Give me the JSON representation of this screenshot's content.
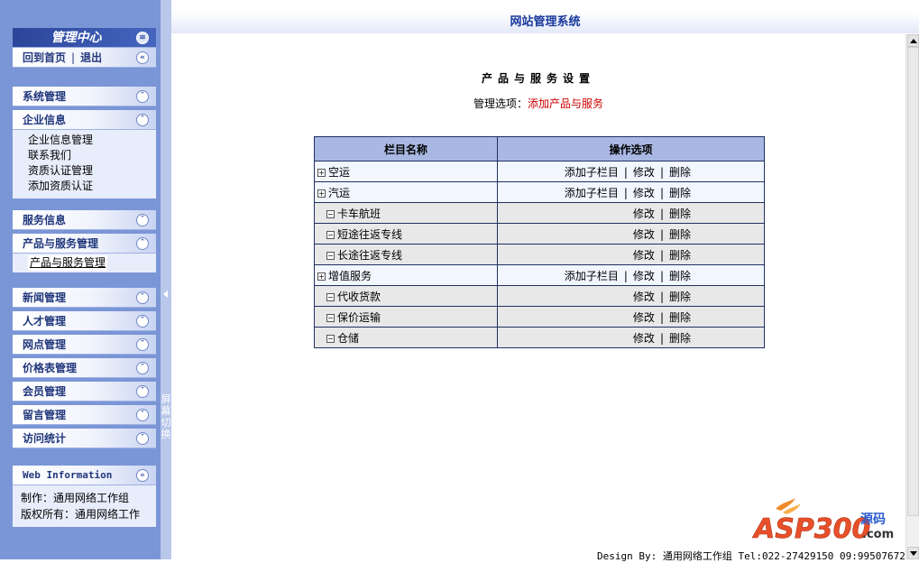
{
  "header": {
    "title": "网站管理系统"
  },
  "sidebar": {
    "center_title": "管理中心",
    "top_links": {
      "home": "回到首页",
      "separator": "|",
      "logout": "退出"
    },
    "menus": [
      {
        "label": "系统管理",
        "expanded": false,
        "items": []
      },
      {
        "label": "企业信息",
        "expanded": true,
        "items": [
          "企业信息管理",
          "联系我们",
          "资质认证管理",
          "添加资质认证"
        ]
      },
      {
        "label": "服务信息",
        "expanded": false,
        "items": []
      },
      {
        "label": "产品与服务管理",
        "expanded": true,
        "items": [
          "产品与服务管理"
        ]
      },
      {
        "label": "新闻管理",
        "expanded": false
      },
      {
        "label": "人才管理",
        "expanded": false
      },
      {
        "label": "网点管理",
        "expanded": false
      },
      {
        "label": "价格表管理",
        "expanded": false
      },
      {
        "label": "会员管理",
        "expanded": false
      },
      {
        "label": "留言管理",
        "expanded": false
      },
      {
        "label": "访问统计",
        "expanded": false
      }
    ],
    "web_info": {
      "title": "Web Information",
      "made_by": "制作：通用网络工作组",
      "copyright": "版权所有：通用网络工作"
    },
    "toggle_label": "屏幕切换"
  },
  "main": {
    "page_title": "产品与服务设置",
    "options_label": "管理选项：",
    "options_link": "添加产品与服务",
    "table": {
      "headers": [
        "栏目名称",
        "操作选项"
      ],
      "rows": [
        {
          "name": "空运",
          "level": "top",
          "actions": [
            "添加子栏目",
            "修改",
            "删除"
          ]
        },
        {
          "name": "汽运",
          "level": "top",
          "actions": [
            "添加子栏目",
            "修改",
            "删除"
          ]
        },
        {
          "name": "卡车航班",
          "level": "sub",
          "actions": [
            "修改",
            "删除"
          ]
        },
        {
          "name": "短途往返专线",
          "level": "sub",
          "actions": [
            "修改",
            "删除"
          ]
        },
        {
          "name": "长途往返专线",
          "level": "sub",
          "actions": [
            "修改",
            "删除"
          ]
        },
        {
          "name": "增值服务",
          "level": "top",
          "actions": [
            "添加子栏目",
            "修改",
            "删除"
          ]
        },
        {
          "name": "代收货款",
          "level": "sub",
          "actions": [
            "修改",
            "删除"
          ]
        },
        {
          "name": "保价运输",
          "level": "sub",
          "actions": [
            "修改",
            "删除"
          ]
        },
        {
          "name": "仓储",
          "level": "sub",
          "actions": [
            "修改",
            "删除"
          ]
        }
      ]
    },
    "logo": {
      "text": "ASP300",
      "sub": "源码",
      "domain": ".com"
    },
    "footer": "Design By: 通用网络工作组 Tel:022-27429150 09:99507672"
  },
  "colors": {
    "sidebar_bg": "#7b96d6",
    "header_blue": "#1a3a9c",
    "link_red": "#cc0000",
    "table_head": "#a9b8e3"
  }
}
